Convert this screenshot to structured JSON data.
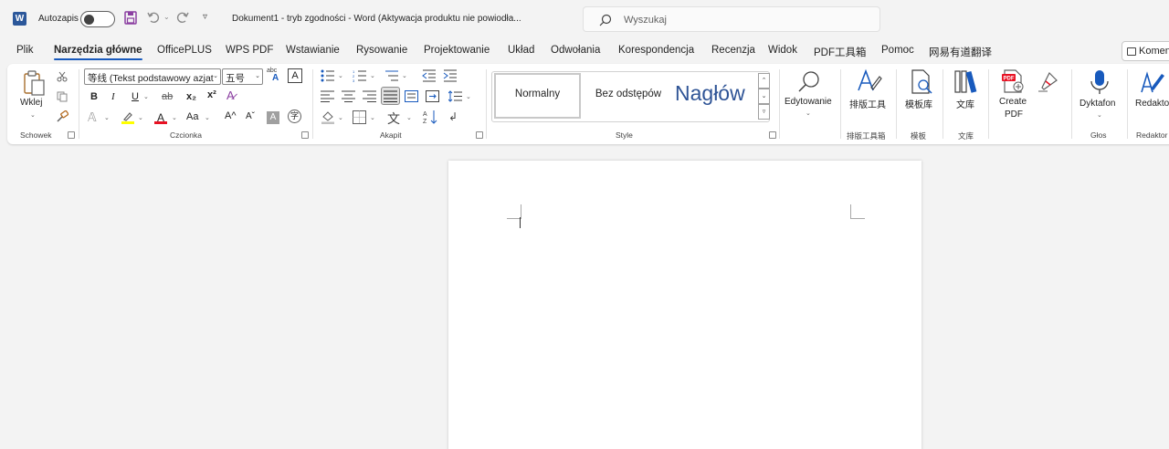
{
  "titlebar": {
    "app_icon_letter": "W",
    "autosave_label": "Autozapis",
    "document_title": "Dokument1  -  tryb zgodności  -  Word (Aktywacja produktu nie powiodła...",
    "search_placeholder": "Wyszukaj"
  },
  "tabs": [
    {
      "label": "Plik"
    },
    {
      "label": "Narzędzia główne"
    },
    {
      "label": "OfficePLUS"
    },
    {
      "label": "WPS PDF"
    },
    {
      "label": "Wstawianie"
    },
    {
      "label": "Rysowanie"
    },
    {
      "label": "Projektowanie"
    },
    {
      "label": "Układ"
    },
    {
      "label": "Odwołania"
    },
    {
      "label": "Korespondencja"
    },
    {
      "label": "Recenzja"
    },
    {
      "label": "Widok"
    },
    {
      "label": "PDF工具箱"
    },
    {
      "label": "Pomoc"
    },
    {
      "label": "网易有道翻译"
    }
  ],
  "comment_button": "Komentarze",
  "ribbon": {
    "clipboard": {
      "paste_label": "Wklej",
      "group_label": "Schowek"
    },
    "font": {
      "font_name": "等线 (Tekst podstawowy azjat",
      "font_size": "五号",
      "bold": "B",
      "italic": "I",
      "underline": "U",
      "strike": "ab",
      "subscript": "x₂",
      "superscript": "x²",
      "change_case": "Aa",
      "grow": "A^",
      "shrink": "Aˇ",
      "char_shading": "A",
      "phonetic": "abc",
      "group_label": "Czcionka"
    },
    "paragraph": {
      "group_label": "Akapit"
    },
    "styles": {
      "items": [
        "Normalny",
        "Bez odstępów",
        "Nagłów"
      ],
      "group_label": "Style"
    },
    "editing": {
      "label": "Edytowanie"
    },
    "layout_tools": {
      "label": "排版工具",
      "group_label": "排版工具箱"
    },
    "templates": {
      "label": "模板库",
      "group_label": "模板"
    },
    "library": {
      "label": "文库",
      "group_label": "文库"
    },
    "create_pdf": {
      "label_line1": "Create",
      "label_line2": "PDF"
    },
    "dictate": {
      "label": "Dyktafon",
      "group_label": "Głos"
    },
    "editor": {
      "label": "Redaktor",
      "group_label": "Redaktor"
    }
  },
  "colors": {
    "accent": "#185abd",
    "highlight": "#ffff00",
    "font_color": "#e81123"
  }
}
